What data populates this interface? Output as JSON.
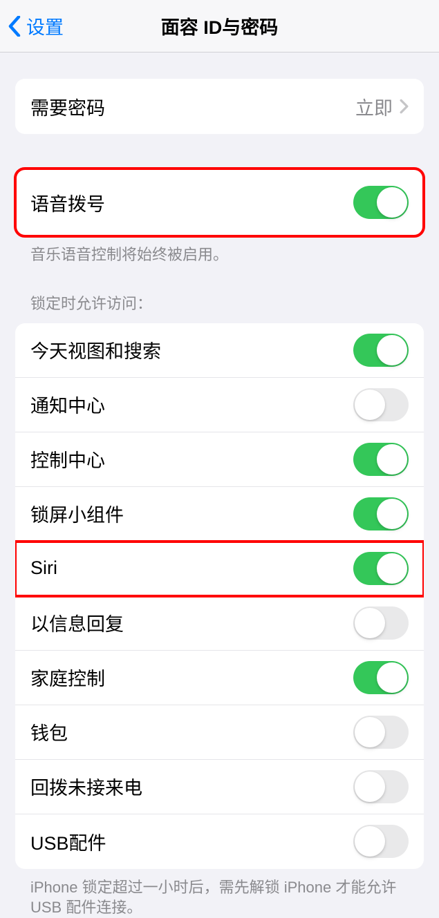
{
  "nav": {
    "back_label": "设置",
    "title": "面容 ID与密码"
  },
  "passcode_section": {
    "label": "需要密码",
    "value": "立即"
  },
  "voice_dial": {
    "label": "语音拨号",
    "on": true,
    "footnote": "音乐语音控制将始终被启用。"
  },
  "lock_access": {
    "header": "锁定时允许访问：",
    "items": [
      {
        "label": "今天视图和搜索",
        "on": true
      },
      {
        "label": "通知中心",
        "on": false
      },
      {
        "label": "控制中心",
        "on": true
      },
      {
        "label": "锁屏小组件",
        "on": true
      },
      {
        "label": "Siri",
        "on": true,
        "highlight": true
      },
      {
        "label": "以信息回复",
        "on": false
      },
      {
        "label": "家庭控制",
        "on": true
      },
      {
        "label": "钱包",
        "on": false
      },
      {
        "label": "回拨未接来电",
        "on": false
      },
      {
        "label": "USB配件",
        "on": false
      }
    ],
    "footer": "iPhone 锁定超过一小时后，需先解锁 iPhone 才能允许USB 配件连接。"
  }
}
